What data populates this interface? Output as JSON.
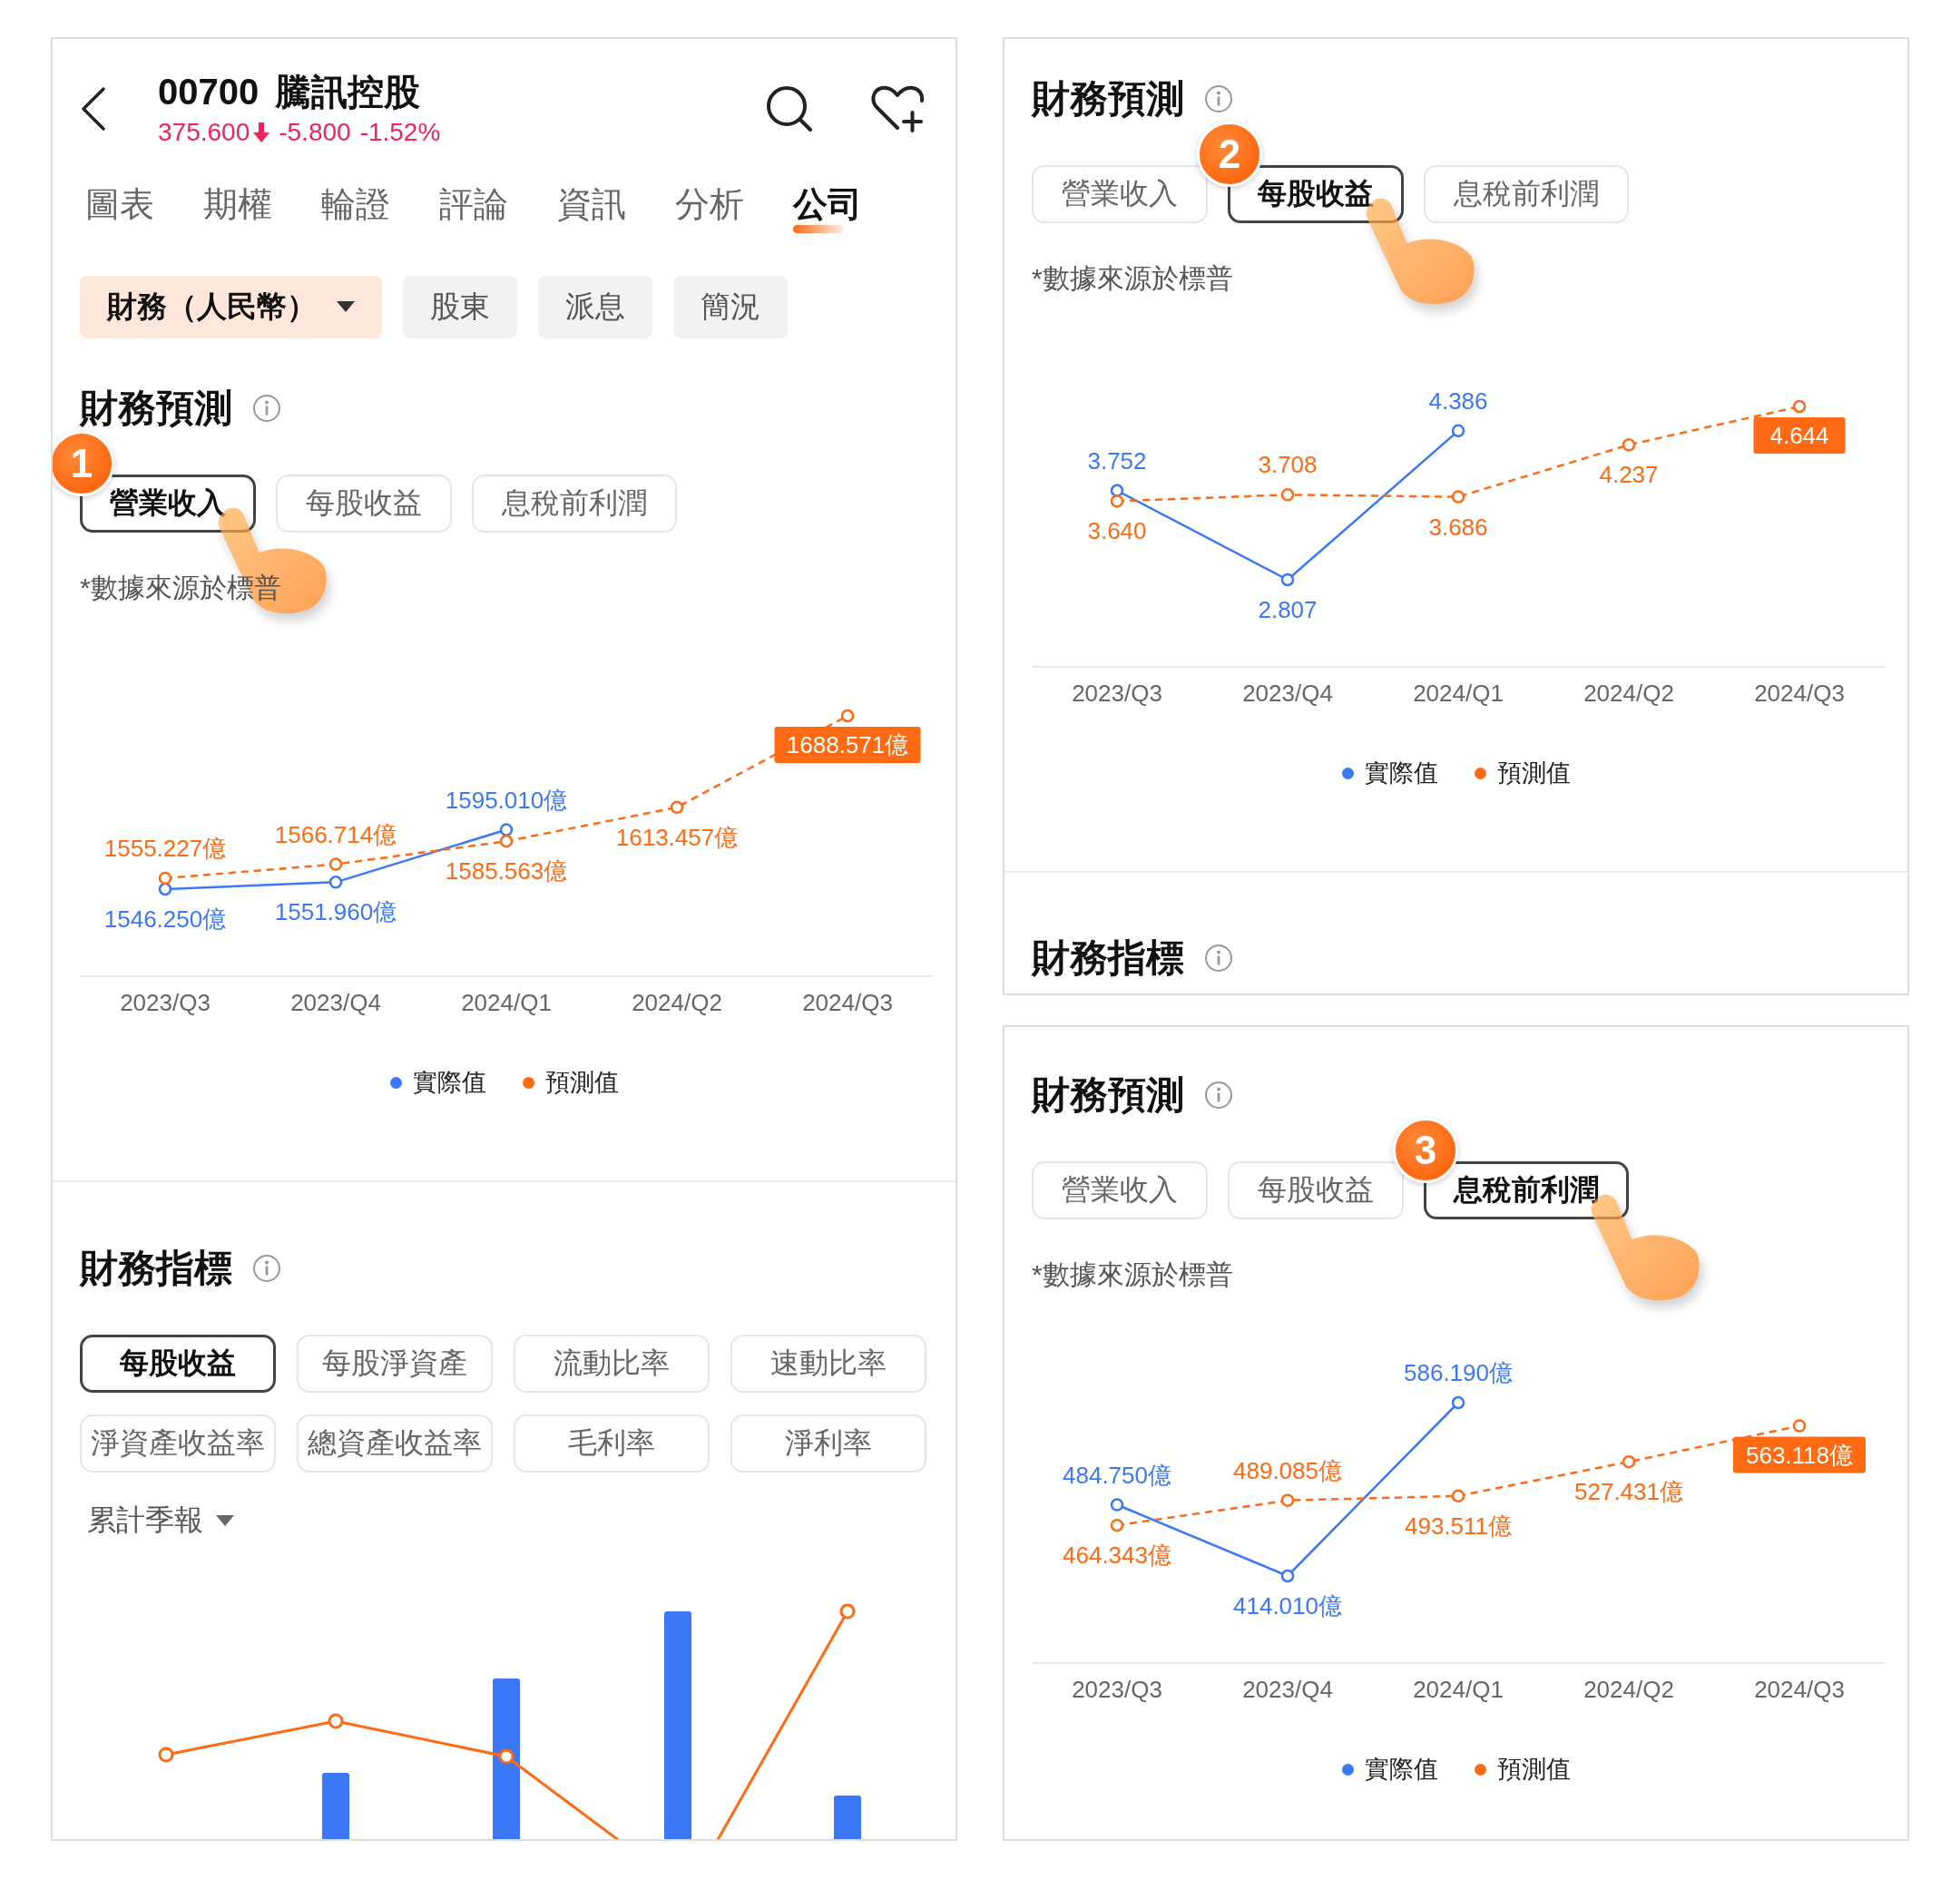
{
  "panels": [
    {
      "kind": "stock",
      "header": {
        "code": "00700",
        "name": "騰訊控股",
        "price": "375.600",
        "change": "-5.800",
        "percent": "-1.52%"
      },
      "nav_tabs": [
        {
          "label": "圖表",
          "selected": false
        },
        {
          "label": "期權",
          "selected": false
        },
        {
          "label": "輪證",
          "selected": false
        },
        {
          "label": "評論",
          "selected": false
        },
        {
          "label": "資訊",
          "selected": false
        },
        {
          "label": "分析",
          "selected": false
        },
        {
          "label": "公司",
          "selected": true
        }
      ],
      "chips": [
        {
          "label": "財務（人民幣）",
          "selected": true,
          "dropdown": true
        },
        {
          "label": "股東",
          "selected": false,
          "dropdown": false
        },
        {
          "label": "派息",
          "selected": false,
          "dropdown": false
        },
        {
          "label": "簡況",
          "selected": false,
          "dropdown": false
        }
      ],
      "forecast": {
        "title": "財務預測",
        "step": "1",
        "tabs": [
          {
            "label": "營業收入",
            "selected": true
          },
          {
            "label": "每股收益",
            "selected": false
          },
          {
            "label": "息稅前利潤",
            "selected": false
          }
        ],
        "note": "*數據來源於標普",
        "chart_data": {
          "type": "line",
          "categories": [
            "2023/Q3",
            "2023/Q4",
            "2024/Q1",
            "2024/Q2",
            "2024/Q3"
          ],
          "data_labels": true,
          "series": [
            {
              "name": "實際值",
              "color": "#3b78f7",
              "line_style": "solid",
              "marker": "circle",
              "values": [
                1546.25,
                1551.96,
                1595.01,
                null,
                null
              ],
              "value_labels": [
                "1546.250億",
                "1551.960億",
                "1595.010億",
                null,
                null
              ]
            },
            {
              "name": "預測值",
              "color": "#ff6a13",
              "line_style": "dashed",
              "marker": "circle",
              "values": [
                1555.227,
                1566.714,
                1585.563,
                1613.457,
                1688.571
              ],
              "value_labels": [
                "1555.227億",
                "1566.714億",
                "1585.563億",
                "1613.457億",
                "1688.571億"
              ]
            }
          ]
        }
      },
      "indicators": {
        "title": "財務指標",
        "tabs": [
          {
            "label": "每股收益",
            "selected": true
          },
          {
            "label": "每股淨資產",
            "selected": false
          },
          {
            "label": "流動比率",
            "selected": false
          },
          {
            "label": "速動比率",
            "selected": false
          },
          {
            "label": "淨資產收益率",
            "selected": false
          },
          {
            "label": "總資產收益率",
            "selected": false
          },
          {
            "label": "毛利率",
            "selected": false
          },
          {
            "label": "淨利率",
            "selected": false
          }
        ],
        "period": "累計季報"
      }
    },
    {
      "kind": "forecast_indicators",
      "forecast": {
        "title": "財務預測",
        "step": "2",
        "tabs": [
          {
            "label": "營業收入",
            "selected": false
          },
          {
            "label": "每股收益",
            "selected": true
          },
          {
            "label": "息稅前利潤",
            "selected": false
          }
        ],
        "note": "*數據來源於標普",
        "chart_data": {
          "type": "line",
          "categories": [
            "2023/Q3",
            "2023/Q4",
            "2024/Q1",
            "2024/Q2",
            "2024/Q3"
          ],
          "data_labels": true,
          "series": [
            {
              "name": "實際值",
              "color": "#3b78f7",
              "line_style": "solid",
              "marker": "circle",
              "values": [
                3.752,
                2.807,
                4.386,
                null,
                null
              ],
              "value_labels": [
                "3.752",
                "2.807",
                "4.386",
                null,
                null
              ]
            },
            {
              "name": "預測值",
              "color": "#ff6a13",
              "line_style": "dashed",
              "marker": "circle",
              "values": [
                3.64,
                3.708,
                3.686,
                4.237,
                4.644
              ],
              "value_labels": [
                "3.640",
                "3.708",
                "3.686",
                "4.237",
                "4.644"
              ]
            }
          ]
        }
      },
      "indicators": {
        "title": "財務指標"
      }
    },
    {
      "kind": "forecast",
      "forecast": {
        "title": "財務預測",
        "step": "3",
        "tabs": [
          {
            "label": "營業收入",
            "selected": false
          },
          {
            "label": "每股收益",
            "selected": false
          },
          {
            "label": "息稅前利潤",
            "selected": true
          }
        ],
        "note": "*數據來源於標普",
        "chart_data": {
          "type": "line",
          "categories": [
            "2023/Q3",
            "2023/Q4",
            "2024/Q1",
            "2024/Q2",
            "2024/Q3"
          ],
          "data_labels": true,
          "series": [
            {
              "name": "實際值",
              "color": "#3b78f7",
              "line_style": "solid",
              "marker": "circle",
              "values": [
                484.75,
                414.01,
                586.19,
                null,
                null
              ],
              "value_labels": [
                "484.750億",
                "414.010億",
                "586.190億",
                null,
                null
              ]
            },
            {
              "name": "預測值",
              "color": "#ff6a13",
              "line_style": "dashed",
              "marker": "circle",
              "values": [
                464.343,
                489.085,
                493.511,
                527.431,
                563.118
              ],
              "value_labels": [
                "464.343億",
                "489.085億",
                "493.511億",
                "527.431億",
                "563.118億"
              ]
            }
          ]
        }
      }
    }
  ]
}
